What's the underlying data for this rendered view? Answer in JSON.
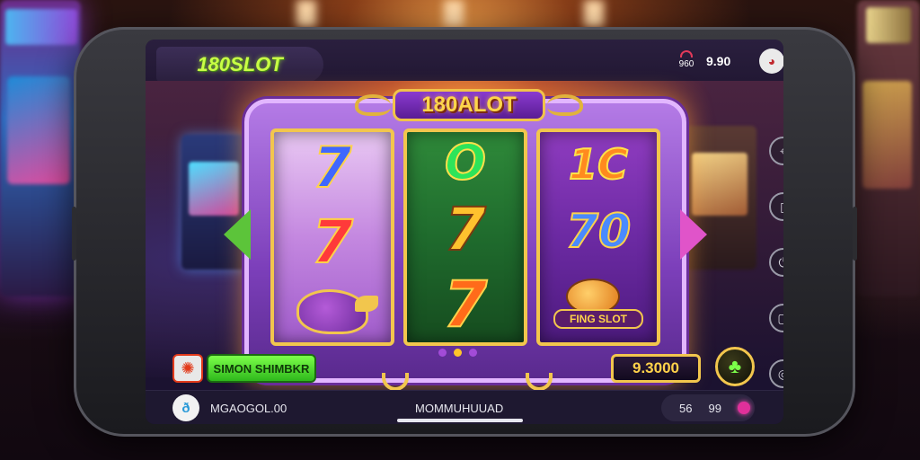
{
  "app": {
    "logo_text": "180SLOT"
  },
  "status_bar": {
    "signal_label": "960",
    "balance": "9.90"
  },
  "machine": {
    "title": "180ALOT",
    "reels": [
      [
        "7",
        "7",
        "bird"
      ],
      [
        "O",
        "7",
        "7"
      ],
      [
        "1C",
        "70",
        "fish"
      ]
    ],
    "fish_label": "FING SLOT"
  },
  "controls": {
    "green_button_label": "SIMON SHIMBKR",
    "win_amount": "9.3000",
    "page_dots": 3
  },
  "bottom_bar": {
    "username": "MGAOGOL.00",
    "center_text": "MOMMUHUUAD",
    "stat_1": "56",
    "stat_2": "99"
  },
  "icons": {
    "spin": "sun-icon",
    "round_button": "clover-icon",
    "side": [
      "map-icon",
      "card-icon",
      "power-icon",
      "info-icon",
      "globe-icon"
    ]
  },
  "colors": {
    "logo_green": "#c9ff45",
    "frame_purple": "#7c3fba",
    "gold": "#f2c64d"
  }
}
